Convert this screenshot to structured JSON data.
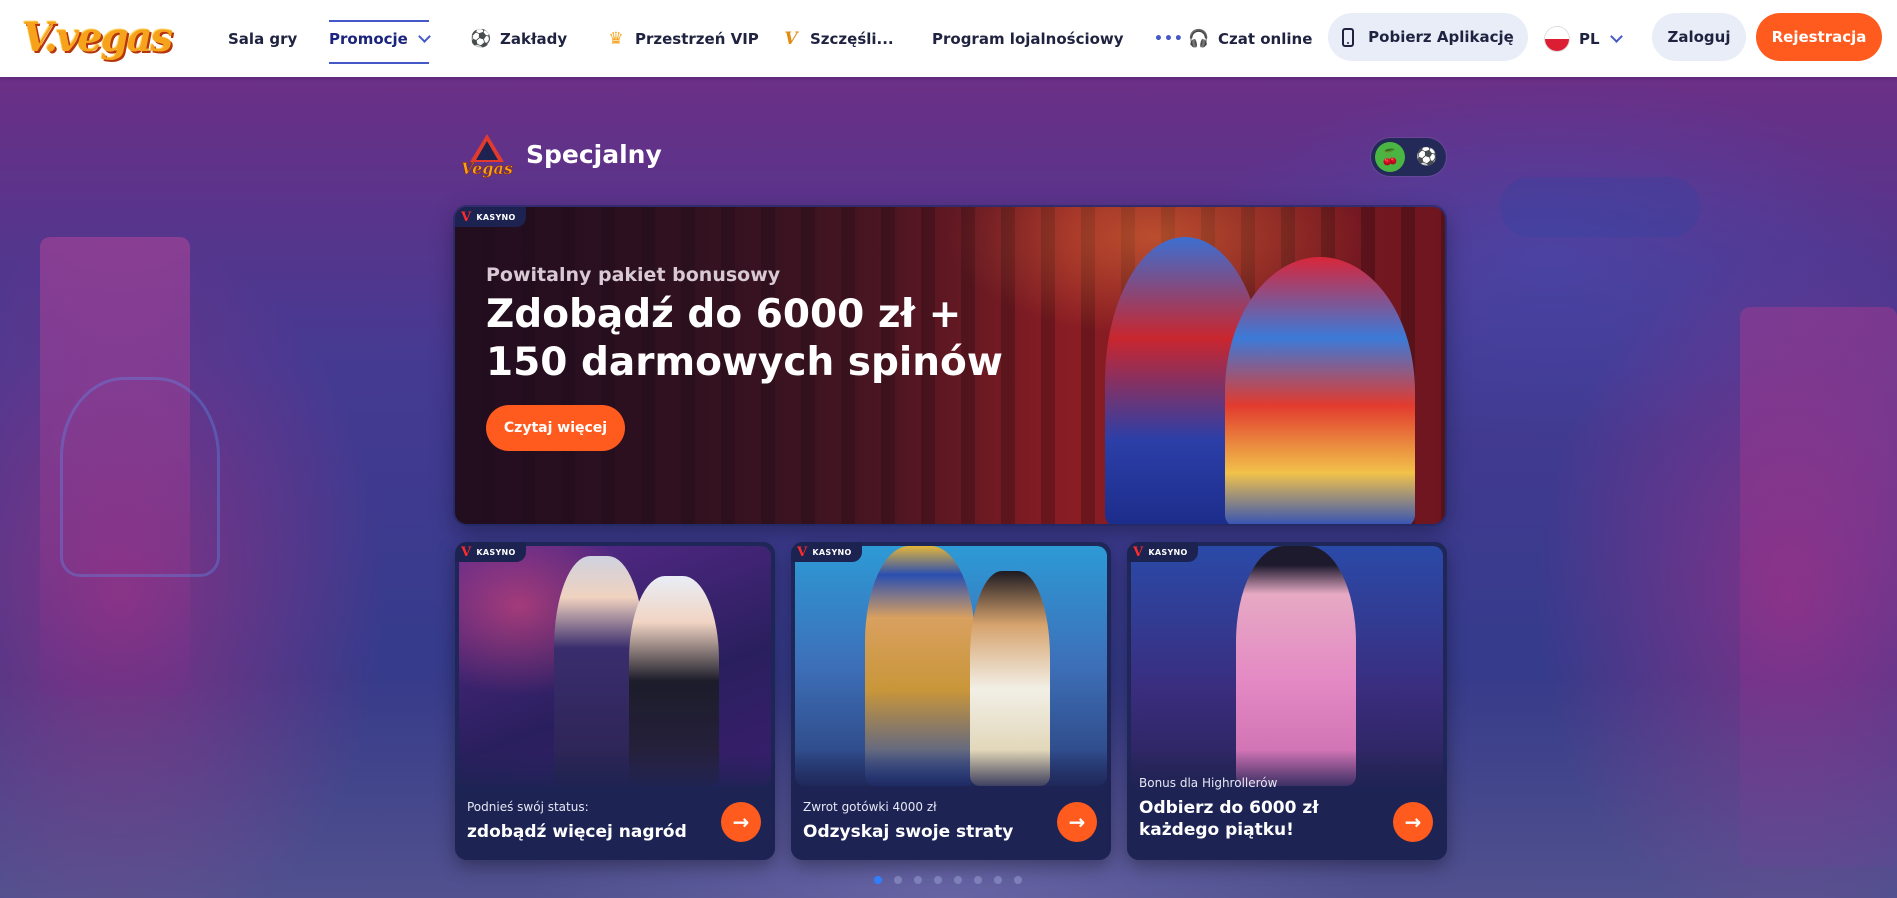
{
  "header": {
    "logo_text": "V.vegas",
    "nav": [
      {
        "label": "Sala gry",
        "icon": ""
      },
      {
        "label": "Promocje",
        "icon": "chevron-down-icon"
      },
      {
        "label": "Zakłady",
        "icon": "soccer-ball-icon"
      },
      {
        "label": "Przestrzeń VIP",
        "icon": "crown-icon"
      },
      {
        "label": "Szczęśli...",
        "icon": "v-logo-icon"
      },
      {
        "label": "Program lojalnościowy",
        "icon": ""
      }
    ],
    "more_label": "•••",
    "chat_label": "Czat online",
    "download_app_label": "Pobierz Aplikację",
    "language": "PL",
    "login_label": "Zaloguj",
    "register_label": "Rejestracja"
  },
  "section": {
    "title": "Specjalny"
  },
  "hero": {
    "badge": "KASYNO",
    "subtitle": "Powitalny pakiet bonusowy",
    "title": "Zdobądź do 6000 zł + 150 darmowych spinów",
    "button_label": "Czytaj więcej"
  },
  "cards": [
    {
      "badge": "KASYNO",
      "kicker": "Podnieś swój status:",
      "title": "zdobądź więcej nagród"
    },
    {
      "badge": "KASYNO",
      "kicker": "Zwrot gotówki 4000 zł",
      "title": "Odzyskaj swoje straty"
    },
    {
      "badge": "KASYNO",
      "kicker": "Bonus dla Highrollerów",
      "title": "Odbierz do 6000 zł każdego piątku!"
    }
  ],
  "carousel": {
    "pages": 8,
    "active_index": 0
  },
  "colors": {
    "accent": "#ff5b1f",
    "toggle_on": "#4bb543",
    "nav_active": "#4458c7"
  }
}
